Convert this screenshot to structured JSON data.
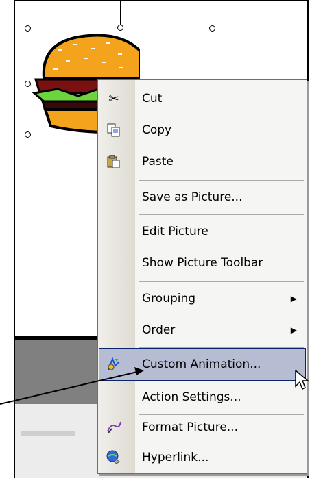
{
  "menu": {
    "items": [
      {
        "label": "Cut",
        "icon": "scissors-icon"
      },
      {
        "label": "Copy",
        "icon": "copy-icon"
      },
      {
        "label": "Paste",
        "icon": "paste-icon"
      },
      {
        "label": "Save as Picture...",
        "icon": ""
      },
      {
        "label": "Edit Picture",
        "icon": ""
      },
      {
        "label": "Show Picture Toolbar",
        "icon": ""
      },
      {
        "label": "Grouping",
        "icon": "",
        "submenu": true
      },
      {
        "label": "Order",
        "icon": "",
        "submenu": true
      },
      {
        "label": "Custom Animation...",
        "icon": "custom-animation-icon",
        "highlighted": true
      },
      {
        "label": "Action Settings...",
        "icon": ""
      },
      {
        "label": "Format Picture...",
        "icon": "format-picture-icon"
      },
      {
        "label": "Hyperlink...",
        "icon": "hyperlink-icon"
      }
    ]
  },
  "colors": {
    "highlight": "#b6bdd2",
    "highlight_border": "#0a246a",
    "menu_bg": "#f5f5f3"
  }
}
